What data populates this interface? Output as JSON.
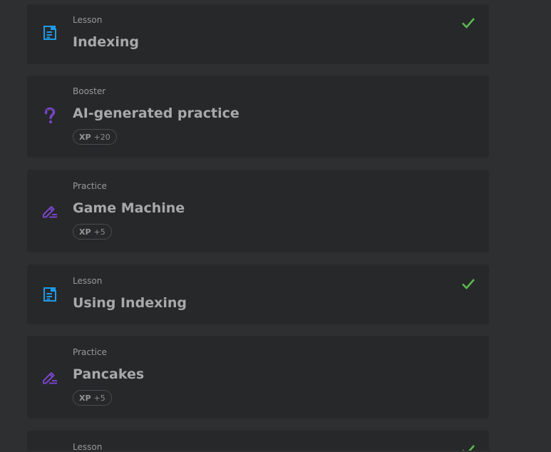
{
  "colors": {
    "page_background": "#2e2f31",
    "card_background": "#27282a",
    "lesson_icon": "#1e9be8",
    "practice_icon": "#7a45c9",
    "booster_icon": "#7a45c9",
    "checkmark": "#5bb950",
    "title_text": "#a9a9a9",
    "type_text": "#9a9a9a"
  },
  "items": [
    {
      "type": "Lesson",
      "title": "Indexing",
      "icon": "lesson-document-icon",
      "completed": true
    },
    {
      "type": "Booster",
      "title": "AI-generated practice",
      "icon": "question-mark-mascot-icon",
      "xp": {
        "label": "XP",
        "value": "+20"
      },
      "completed": false
    },
    {
      "type": "Practice",
      "title": "Game Machine",
      "icon": "pencil-edit-icon",
      "xp": {
        "label": "XP",
        "value": "+5"
      },
      "completed": false
    },
    {
      "type": "Lesson",
      "title": "Using Indexing",
      "icon": "lesson-document-icon",
      "completed": true
    },
    {
      "type": "Practice",
      "title": "Pancakes",
      "icon": "pencil-edit-icon",
      "xp": {
        "label": "XP",
        "value": "+5"
      },
      "completed": false
    },
    {
      "type": "Lesson",
      "title": "",
      "icon": "lesson-document-icon",
      "completed": true
    }
  ]
}
